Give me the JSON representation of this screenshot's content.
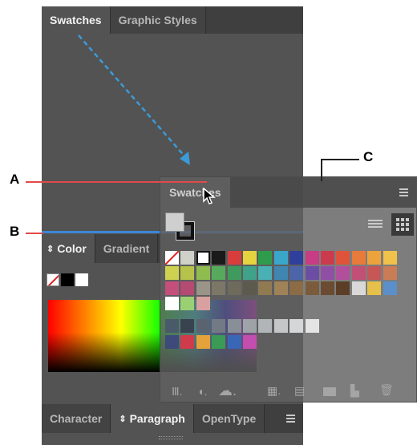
{
  "annotations": {
    "a": "A",
    "b": "B",
    "c": "C"
  },
  "top_group": {
    "tabs": [
      "Swatches",
      "Graphic Styles"
    ]
  },
  "color_group": {
    "tabs": [
      "Color",
      "Gradient"
    ]
  },
  "bottom_group": {
    "tabs": [
      "Character",
      "Paragraph",
      "OpenType"
    ]
  },
  "floating_panel": {
    "tab": "Swatches"
  },
  "colors": {
    "panel_bg": "#535353",
    "tab_bar": "#3f3f3f",
    "drop_line": "#3c87d6",
    "callout_line": "#e24a4a"
  },
  "swatch_rows": [
    [
      "#ffffff",
      "#cfd0c8",
      "#ffffff",
      "#1a1a1a",
      "#d83d3d",
      "#e5d33f",
      "#2f9c4d",
      "#3aa6c9",
      "#2f3f9c",
      "#c63c85",
      "#cc3b4d",
      "#e0533b",
      "#e77b3b",
      "#eda33b",
      "#f0c14b"
    ],
    [
      "#cfd24f",
      "#b6c24a",
      "#8fbc4f",
      "#57a95b",
      "#3f9a5e",
      "#3fa38a",
      "#4ab0b4",
      "#3f86b0",
      "#4c65a8",
      "#6b4ea3",
      "#8f4fa5",
      "#b14f9d",
      "#c24f75",
      "#c75656",
      "#c97c55"
    ],
    [
      "#c44f7b",
      "#b54a73",
      "#9b9488",
      "#7d7768",
      "#6e6a5c",
      "#5c5a4d",
      "#8f7a52",
      "#a08258",
      "#8b6c47",
      "#7a5b3b",
      "#6b4b31",
      "#5c3e27",
      "#d9d9d9",
      "#e5c04a",
      "#5b8fc9"
    ],
    [
      "#ffffff",
      "#9bcf74",
      "#d9a0a0"
    ],
    [
      "#4a5a6a",
      "#39424f",
      "#5a6470",
      "#727b85",
      "#888f97",
      "#9ea3a8",
      "#b2b5b8",
      "#c4c6c8",
      "#d5d6d7",
      "#e4e4e4"
    ],
    [
      "#3d4a7a",
      "#cf3b4a",
      "#e6a23a",
      "#3b9a55",
      "#3a67b5",
      "#c44db0"
    ]
  ]
}
